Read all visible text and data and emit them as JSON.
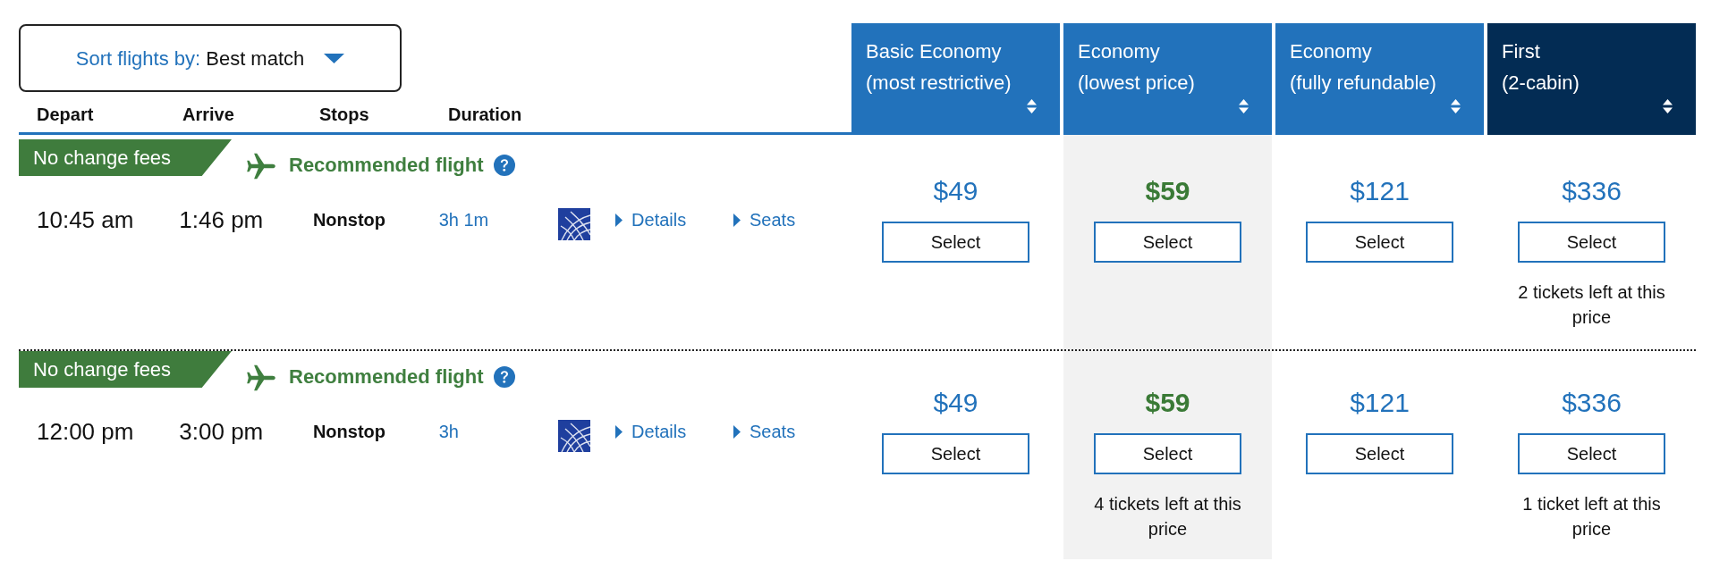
{
  "sort": {
    "label": "Sort flights by:",
    "value": "Best match"
  },
  "columns": [
    "Depart",
    "Arrive",
    "Stops",
    "Duration"
  ],
  "fare_columns": [
    {
      "title": "Basic Economy",
      "subtitle": "(most restrictive)",
      "kind": "standard",
      "highlighted": false
    },
    {
      "title": "Economy",
      "subtitle": "(lowest price)",
      "kind": "standard",
      "highlighted": true
    },
    {
      "title": "Economy",
      "subtitle": "(fully refundable)",
      "kind": "standard",
      "highlighted": false
    },
    {
      "title": "First",
      "subtitle": "(2-cabin)",
      "kind": "premium",
      "highlighted": false
    }
  ],
  "flights": [
    {
      "badge": "No change fees",
      "recommendation": "Recommended flight",
      "depart": "10:45 am",
      "arrive": "1:46 pm",
      "stops": "Nonstop",
      "duration": "3h 1m",
      "links": [
        "Details",
        "Seats"
      ],
      "fares": [
        {
          "price": "$49",
          "button": "Select"
        },
        {
          "price": "$59",
          "button": "Select"
        },
        {
          "price": "$121",
          "button": "Select"
        },
        {
          "price": "$336",
          "button": "Select",
          "note": "2 tickets left at this price"
        }
      ]
    },
    {
      "badge": "No change fees",
      "recommendation": "Recommended flight",
      "depart": "12:00 pm",
      "arrive": "3:00 pm",
      "stops": "Nonstop",
      "duration": "3h",
      "links": [
        "Details",
        "Seats"
      ],
      "fares": [
        {
          "price": "$49",
          "button": "Select"
        },
        {
          "price": "$59",
          "button": "Select",
          "note": "4 tickets left at this price"
        },
        {
          "price": "$121",
          "button": "Select"
        },
        {
          "price": "$336",
          "button": "Select",
          "note": "1 ticket left at this price"
        }
      ]
    }
  ]
}
